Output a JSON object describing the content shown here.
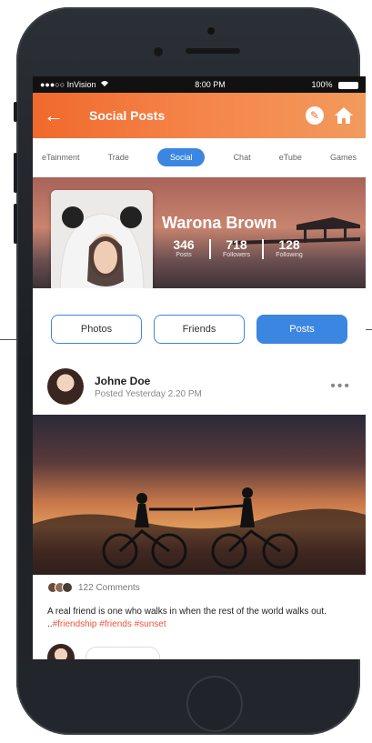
{
  "status_bar": {
    "carrier": "●●●○○ InVision",
    "time": "8:00 PM",
    "battery": "100%"
  },
  "header": {
    "title": "Social Posts",
    "back_icon": "back-arrow-icon",
    "edit_icon": "edit-icon",
    "home_icon": "home-icon"
  },
  "tabs": [
    {
      "label": "eTainment"
    },
    {
      "label": "Trade"
    },
    {
      "label": "Social",
      "active": true
    },
    {
      "label": "Chat"
    },
    {
      "label": "eTube"
    },
    {
      "label": "Games"
    }
  ],
  "profile": {
    "name": "Warona Brown",
    "stats": [
      {
        "value": "346",
        "label": "Posts"
      },
      {
        "value": "718",
        "label": "Followers"
      },
      {
        "value": "128",
        "label": "Following"
      }
    ]
  },
  "profile_tabs": {
    "photos": "Photos",
    "friends": "Friends",
    "posts": "Posts"
  },
  "post": {
    "author": "Johne Doe",
    "time": "Posted Yesterday 2.20 PM",
    "comments": "122 Comments",
    "caption": "A real friend is one who walks in when the rest of the world walks out. ..",
    "tags": "#friendship #friends #sunset"
  },
  "colors": {
    "accent": "#f0692c",
    "primary_blue": "#3b86e0",
    "tag_red": "#e8553d"
  }
}
